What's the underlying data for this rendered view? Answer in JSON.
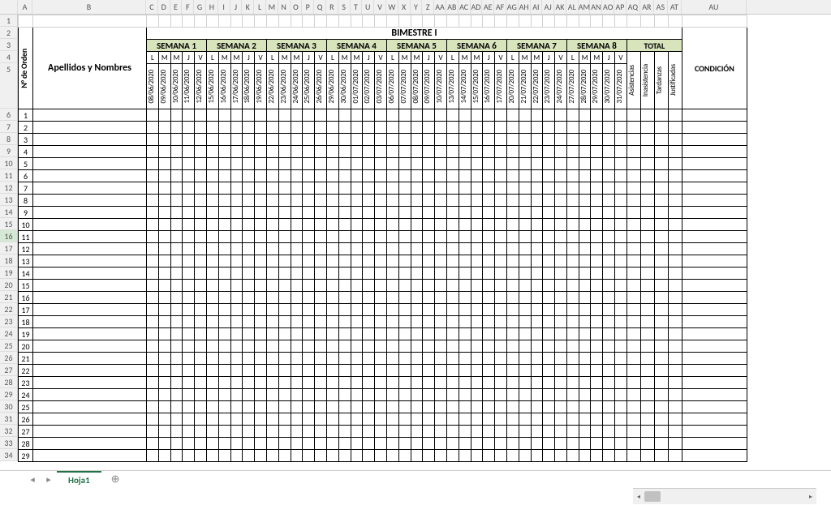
{
  "columnHeaders": [
    "A",
    "B",
    "C",
    "D",
    "E",
    "F",
    "G",
    "H",
    "I",
    "J",
    "K",
    "L",
    "M",
    "N",
    "O",
    "P",
    "Q",
    "R",
    "S",
    "T",
    "U",
    "V",
    "W",
    "X",
    "Y",
    "Z",
    "AA",
    "AB",
    "AC",
    "AD",
    "AE",
    "AF",
    "AG",
    "AH",
    "AI",
    "AJ",
    "AK",
    "AL",
    "AM",
    "AN",
    "AO",
    "AP",
    "AQ",
    "AR",
    "AS",
    "AT",
    "AU"
  ],
  "rowHeaders": [
    "1",
    "2",
    "3",
    "4",
    "5",
    "6",
    "7",
    "8",
    "9",
    "10",
    "11",
    "12",
    "13",
    "14",
    "15",
    "16",
    "17",
    "18",
    "19",
    "20",
    "21",
    "22",
    "23",
    "24",
    "25",
    "26",
    "27",
    "28",
    "29",
    "30",
    "31",
    "32",
    "33",
    "34"
  ],
  "selectedRow": "16",
  "sheet": {
    "orderLabel": "N° de Orden",
    "namesLabel": "Apellidos y Nombres",
    "bimesterLabel": "BIMESTRE I",
    "conditionLabel": "CONDICIÓN",
    "weeks": [
      "SEMANA 1",
      "SEMANA 2",
      "SEMANA 3",
      "SEMANA 4",
      "SEMANA 5",
      "SEMANA 6",
      "SEMANA 7",
      "SEMANA 8"
    ],
    "totalLabel": "TOTAL",
    "days": [
      "L",
      "M",
      "M",
      "J",
      "V"
    ],
    "dates": [
      [
        "08/06/2020",
        "09/06/2020",
        "10/06/2020",
        "11/06/2020",
        "12/06/2020"
      ],
      [
        "15/06/2020",
        "16/06/2020",
        "17/06/2020",
        "18/06/2020",
        "19/06/2020"
      ],
      [
        "22/06/2020",
        "23/06/2020",
        "24/06/2020",
        "25/06/2020",
        "26/06/2020"
      ],
      [
        "29/06/2020",
        "30/06/2020",
        "01/07/2020",
        "02/07/2020",
        "03/07/2020"
      ],
      [
        "06/07/2020",
        "07/07/2020",
        "08/07/2020",
        "09/07/2020",
        "10/07/2020"
      ],
      [
        "13/07/2020",
        "14/07/2020",
        "15/07/2020",
        "16/07/2020",
        "17/07/2020"
      ],
      [
        "20/07/2020",
        "21/07/2020",
        "22/07/2020",
        "23/07/2020",
        "24/07/2020"
      ],
      [
        "27/07/2020",
        "28/07/2020",
        "29/07/2020",
        "30/07/2020",
        "31/07/2020"
      ]
    ],
    "totals": [
      "Asistencias",
      "Inasistencia",
      "Tardanzas",
      "Justificadas"
    ],
    "dataRowCount": 29
  },
  "tabs": {
    "active": "Hoja1",
    "addSymbol": "⊕",
    "prev": "◂",
    "next": "▸"
  }
}
